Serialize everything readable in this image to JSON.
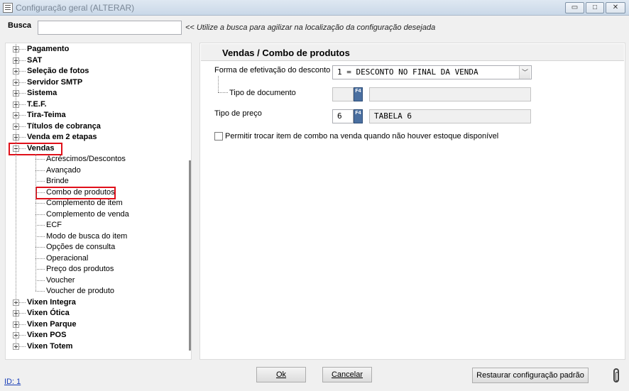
{
  "window": {
    "title": "Configuração geral (ALTERAR)",
    "minimize_symbol": "▭",
    "maximize_symbol": "□",
    "close_symbol": "✕"
  },
  "search": {
    "label": "Busca",
    "value": "",
    "hint": "<< Utilize a busca para agilizar na localização da configuração desejada"
  },
  "tree": {
    "items_top": [
      "Pagamento",
      "SAT",
      "Seleção de fotos",
      "Servidor SMTP",
      "Sistema",
      "T.E.F.",
      "Tira-Teima",
      "Títulos de cobrança",
      "Venda em 2 etapas"
    ],
    "expanded": "Vendas",
    "children": [
      "Acréscimos/Descontos",
      "Avançado",
      "Brinde",
      "Combo de produtos",
      "Complemento de item",
      "Complemento de venda",
      "ECF",
      "Modo de busca do item",
      "Opções de consulta",
      "Operacional",
      "Preço dos produtos",
      "Voucher",
      "Voucher de produto"
    ],
    "selected_child": "Combo de produtos",
    "items_bottom": [
      "Vixen Integra",
      "Vixen Ótica",
      "Vixen Parque",
      "Vixen POS",
      "Vixen Totem"
    ]
  },
  "form": {
    "section_title": "Vendas / Combo de produtos",
    "discount_label": "Forma de efetivação do desconto",
    "discount_value": "1 = DESCONTO NO FINAL DA VENDA",
    "combo_arrow": "﹀",
    "doc_type_label": "Tipo de documento",
    "doc_type_code": "",
    "doc_type_desc": "",
    "price_type_label": "Tipo de preço",
    "price_type_code": "6",
    "price_type_desc": "TABELA 6",
    "f4_label": "F4",
    "checkbox_label": "Permitir trocar item de combo na venda quando não houver estoque disponível",
    "checkbox_checked": false
  },
  "footer": {
    "ok_label": "Ok",
    "cancel_label": "Cancelar",
    "restore_label": "Restaurar configuração padrão",
    "id_text": "ID: 1"
  },
  "colors": {
    "highlight": "#e0101a",
    "f4_button": "#4a6fa0",
    "link": "#1a3fb8"
  }
}
